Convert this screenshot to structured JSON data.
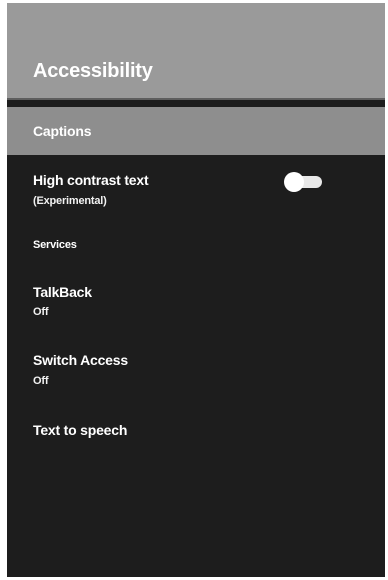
{
  "header": {
    "title": "Accessibility"
  },
  "items": {
    "captions": {
      "label": "Captions"
    },
    "high_contrast": {
      "label": "High contrast text",
      "sublabel": "(Experimental)",
      "toggle_on": true
    },
    "services": {
      "label": "Services"
    },
    "talkback": {
      "label": "TalkBack",
      "status": "Off"
    },
    "switch_access": {
      "label": "Switch Access",
      "status": "Off"
    },
    "text_to_speech": {
      "label": "Text to speech"
    }
  },
  "colors": {
    "header_bg": "#9a9a9a",
    "selected_row_bg": "#8e8e8e",
    "list_bg": "#1d1d1d",
    "text": "#ffffff"
  }
}
